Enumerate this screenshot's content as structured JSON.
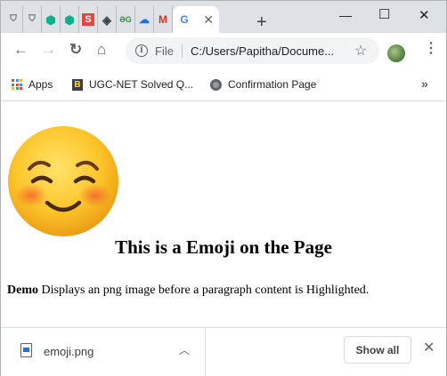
{
  "tabs": [
    {
      "icon": "shield-favicon",
      "color": "#5f6368"
    },
    {
      "icon": "shield-favicon",
      "color": "#5f6368"
    },
    {
      "icon": "hexagon-favicon",
      "color": "#0ab28b"
    },
    {
      "icon": "hexagon-favicon",
      "color": "#0ab28b"
    },
    {
      "icon": "s-favicon",
      "color": "#e8453c"
    },
    {
      "icon": "diamond-favicon",
      "color": "#3c4043"
    },
    {
      "icon": "gg-favicon",
      "color": "#2f8d46"
    },
    {
      "icon": "cloud-favicon",
      "color": "#1a73e8"
    },
    {
      "icon": "gmail-favicon",
      "color": "#d93025"
    },
    {
      "icon": "google-favicon",
      "color": "#4285f4"
    }
  ],
  "tab_glyphs": [
    "⛉",
    "⛉",
    "⬢",
    "⬢",
    "S",
    "◈",
    "ƏG",
    "☁",
    "M",
    "G"
  ],
  "address_bar": {
    "scheme_label": "File",
    "url": "C:/Users/Papitha/Docume..."
  },
  "bookmarks": {
    "apps_label": "Apps",
    "item1_label": "UGC-NET Solved Q...",
    "item2_label": "Confirmation Page",
    "more_label": "»"
  },
  "page": {
    "heading": "This is a Emoji on the Page",
    "para_bold": "Demo",
    "para_text": " Displays an png image before a paragraph content is Highlighted."
  },
  "downloads": {
    "filename": "emoji.png",
    "show_all_label": "Show all"
  },
  "colors": {
    "tabstrip_bg": "#dee1e6",
    "omnibox_bg": "#f1f3f4",
    "link_blue": "#1a73e8"
  }
}
